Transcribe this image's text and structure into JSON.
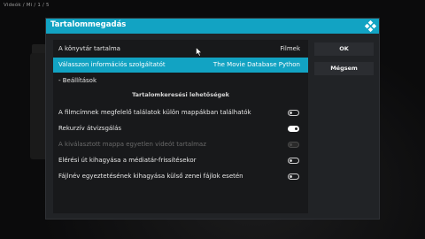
{
  "background": {
    "path_text": "Videók / Mi / 1 / 5"
  },
  "dialog": {
    "title": "Tartalommegadás",
    "logo_icon": "kodi-logo-icon",
    "rows": [
      {
        "label": "A könyvtár tartalma",
        "value": "Filmek"
      },
      {
        "label": "Válasszon információs szolgáltatót",
        "value": "The Movie Database Python",
        "selected": true
      },
      {
        "label": "- Beállítások",
        "value": ""
      }
    ],
    "section_title": "Tartalomkeresési lehetőségek",
    "options": [
      {
        "label": "A filmcímnek megfelelő találatok külön mappákban találhatók",
        "toggle": "off"
      },
      {
        "label": "Rekurzív átvizsgálás",
        "toggle": "on"
      },
      {
        "label": "A kiválasztott mappa egyetlen videót tartalmaz",
        "toggle": "disabled"
      },
      {
        "label": "Elérési út kihagyása a médiatár-frissítésekor",
        "toggle": "off"
      },
      {
        "label": "Fájlnév egyeztetésének kihagyása külső zenei fájlok esetén",
        "toggle": "off"
      }
    ],
    "buttons": {
      "ok": "OK",
      "cancel": "Mégsem"
    }
  },
  "colors": {
    "accent": "#12a3c3",
    "dialog_bg": "#212326",
    "list_bg": "#18191b"
  }
}
